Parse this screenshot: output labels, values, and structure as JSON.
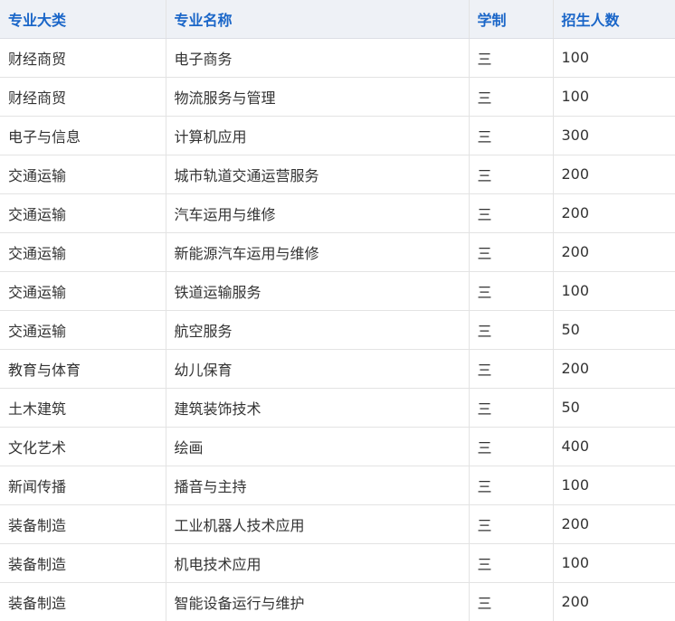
{
  "table": {
    "headers": [
      "专业大类",
      "专业名称",
      "学制",
      "招生人数"
    ],
    "rows": [
      [
        "财经商贸",
        "电子商务",
        "三",
        "100"
      ],
      [
        "财经商贸",
        "物流服务与管理",
        "三",
        "100"
      ],
      [
        "电子与信息",
        "计算机应用",
        "三",
        "300"
      ],
      [
        "交通运输",
        "城市轨道交通运营服务",
        "三",
        "200"
      ],
      [
        "交通运输",
        "汽车运用与维修",
        "三",
        "200"
      ],
      [
        "交通运输",
        "新能源汽车运用与维修",
        "三",
        "200"
      ],
      [
        "交通运输",
        "铁道运输服务",
        "三",
        "100"
      ],
      [
        "交通运输",
        "航空服务",
        "三",
        "50"
      ],
      [
        "教育与体育",
        "幼儿保育",
        "三",
        "200"
      ],
      [
        "土木建筑",
        "建筑装饰技术",
        "三",
        "50"
      ],
      [
        "文化艺术",
        "绘画",
        "三",
        "400"
      ],
      [
        "新闻传播",
        "播音与主持",
        "三",
        "100"
      ],
      [
        "装备制造",
        "工业机器人技术应用",
        "三",
        "200"
      ],
      [
        "装备制造",
        "机电技术应用",
        "三",
        "100"
      ],
      [
        "装备制造",
        "智能设备运行与维护",
        "三",
        "200"
      ]
    ]
  }
}
